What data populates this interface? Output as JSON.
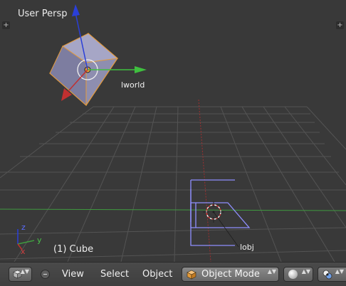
{
  "viewport": {
    "perspective_label": "User Persp",
    "active_object_label": "(1) Cube",
    "objects": [
      {
        "name": "lworld"
      },
      {
        "name": "lobj"
      }
    ],
    "axis_gizmo": {
      "z": "z",
      "y": "y",
      "x": "x"
    },
    "add_buttons": [
      "+",
      "+"
    ]
  },
  "header": {
    "menus": [
      "View",
      "Select",
      "Object"
    ],
    "mode": "Object Mode",
    "spinner_glyph": "▲▼"
  },
  "colors": {
    "viewport_bg": "#393939",
    "grid": "#555555",
    "x_axis": "#a03030",
    "y_axis": "#3f9a3f",
    "z_axis": "#2a3fd8",
    "selection_outline": "#e49b3d",
    "lattice": "#8f8fff"
  },
  "icons": [
    "view3d-cube-icon",
    "collapse-menu-icon",
    "object-mode-cube-icon",
    "viewport-shading-sphere-icon",
    "pivot-point-icon",
    "3d-cursor-icon"
  ]
}
